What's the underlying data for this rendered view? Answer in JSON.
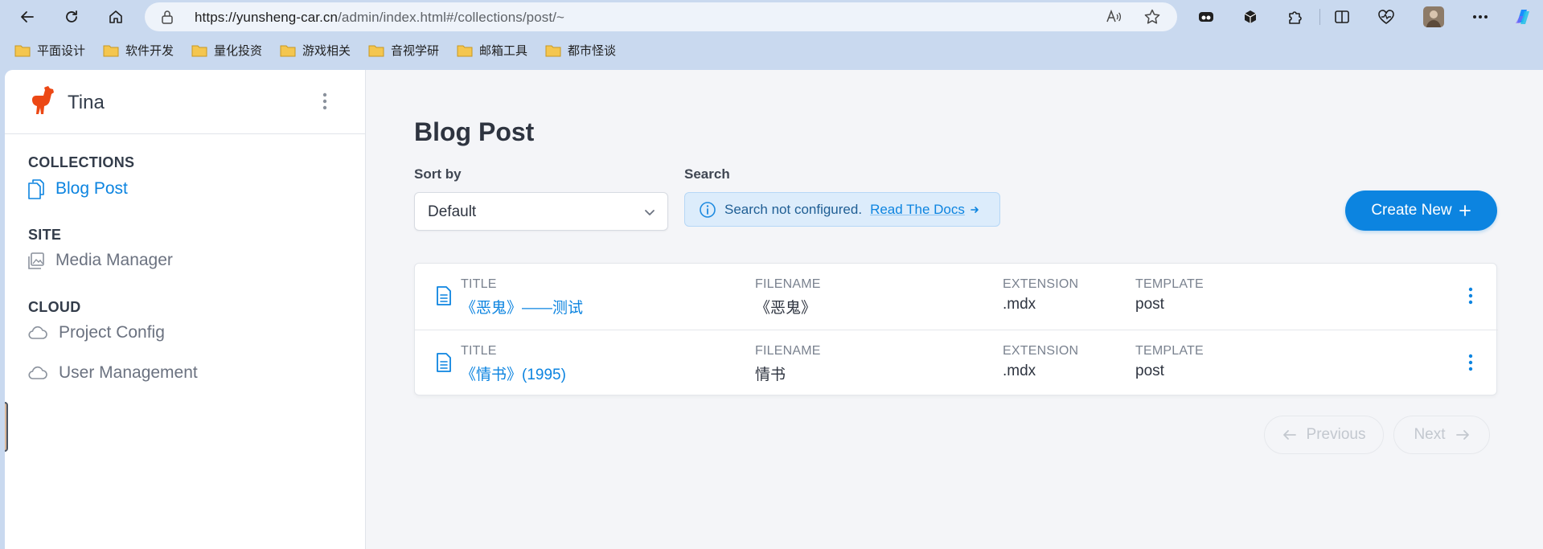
{
  "browser": {
    "url_host": "https://yunsheng-car.cn",
    "url_path": "/admin/index.html#/collections/post/~"
  },
  "bookmarks": [
    {
      "label": "平面设计"
    },
    {
      "label": "软件开发"
    },
    {
      "label": "量化投资"
    },
    {
      "label": "游戏相关"
    },
    {
      "label": "音视学研"
    },
    {
      "label": "邮箱工具"
    },
    {
      "label": "都市怪谈"
    }
  ],
  "sidebar": {
    "brand": "Tina",
    "sections": [
      {
        "title": "COLLECTIONS",
        "items": [
          {
            "label": "Blog Post",
            "icon": "document-duplicate-icon",
            "active": true
          }
        ]
      },
      {
        "title": "SITE",
        "items": [
          {
            "label": "Media Manager",
            "icon": "images-icon"
          }
        ]
      },
      {
        "title": "CLOUD",
        "items": [
          {
            "label": "Project Config",
            "icon": "cloud-icon"
          },
          {
            "label": "User Management",
            "icon": "cloud-icon"
          }
        ]
      }
    ]
  },
  "main": {
    "title": "Blog Post",
    "sort_label": "Sort by",
    "sort_value": "Default",
    "search_label": "Search",
    "search_message": "Search not configured.",
    "search_link": "Read The Docs",
    "create_label": "Create New",
    "columns": {
      "title": "TITLE",
      "filename": "FILENAME",
      "extension": "EXTENSION",
      "template": "TEMPLATE"
    },
    "rows": [
      {
        "title": "《恶鬼》——测试",
        "filename": "《恶鬼》",
        "extension": ".mdx",
        "template": "post"
      },
      {
        "title": "《情书》(1995)",
        "filename": "情书",
        "extension": ".mdx",
        "template": "post"
      }
    ],
    "pagination": {
      "previous": "Previous",
      "next": "Next"
    }
  },
  "colors": {
    "accent": "#0c84e0",
    "sidebar_bg": "#ffffff",
    "main_bg": "#f4f5f8",
    "brand_logo": "#ec4815"
  }
}
